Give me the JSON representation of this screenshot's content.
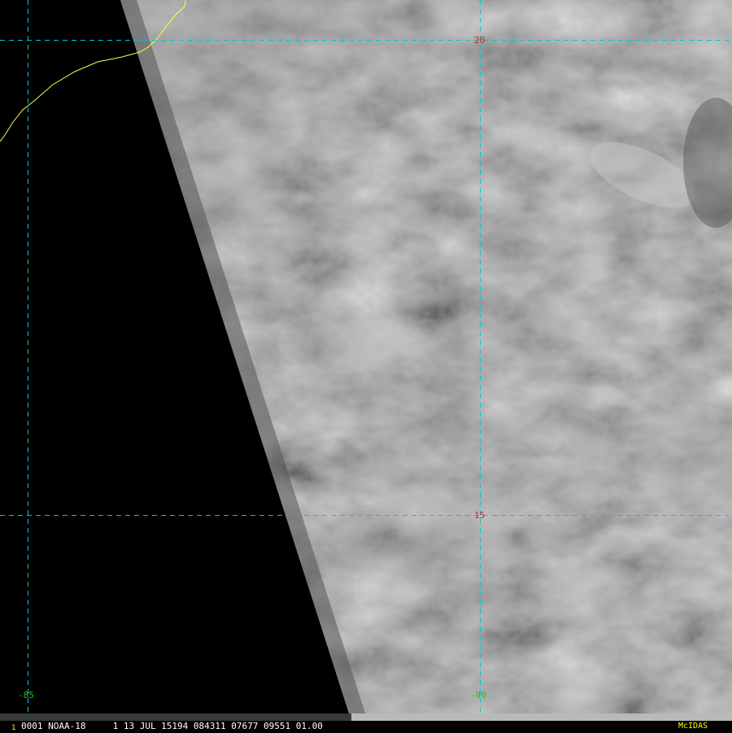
{
  "image": {
    "satellite": "NOAA-18",
    "frame_number": "0001",
    "band": "1",
    "date": "13 JUL 15194",
    "time": "084311",
    "line": "07677",
    "element": "09551",
    "resolution": "01.00",
    "software": "McIDAS",
    "frame_indicator": "1"
  },
  "grid": {
    "latitudes": [
      "20",
      "15"
    ],
    "longitudes": [
      "-85",
      "-90"
    ],
    "line_color": "#00c8c8",
    "lat_label_color": "#e02020",
    "lon_label_color": "#20c020"
  },
  "coastline_color": "#ffff40",
  "software_label_color": "#ffff00",
  "status_text": "0001 NOAA-18     1 13 JUL 15194 084311 07677 09551 01.00"
}
